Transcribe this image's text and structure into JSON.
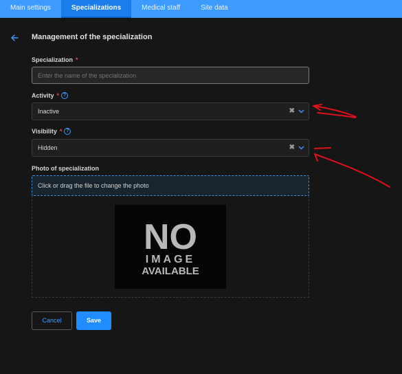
{
  "tabs": [
    {
      "label": "Main settings"
    },
    {
      "label": "Specializations"
    },
    {
      "label": "Medical staff"
    },
    {
      "label": "Site data"
    }
  ],
  "header": {
    "title": "Management of the specialization"
  },
  "form": {
    "specialization": {
      "label": "Specialization",
      "required": "*",
      "placeholder": "Enter the name of the specialization"
    },
    "activity": {
      "label": "Activity",
      "required": "*",
      "help": "?",
      "value": "Inactive",
      "clear": "✖"
    },
    "visibility": {
      "label": "Visibility",
      "required": "*",
      "help": "?",
      "value": "Hidden",
      "clear": "✖"
    },
    "photo": {
      "label": "Photo of specialization",
      "dropzone_text": "Click or drag the file to change the photo"
    }
  },
  "placeholder_image": {
    "line1": "NO",
    "line2": "IMAGE",
    "line3": "AVAILABLE"
  },
  "actions": {
    "cancel": "Cancel",
    "save": "Save"
  },
  "colors": {
    "accent": "#3d9bff",
    "tabbar": "#3d9bff",
    "required": "#e04a4a",
    "annotation": "#e0101a"
  }
}
